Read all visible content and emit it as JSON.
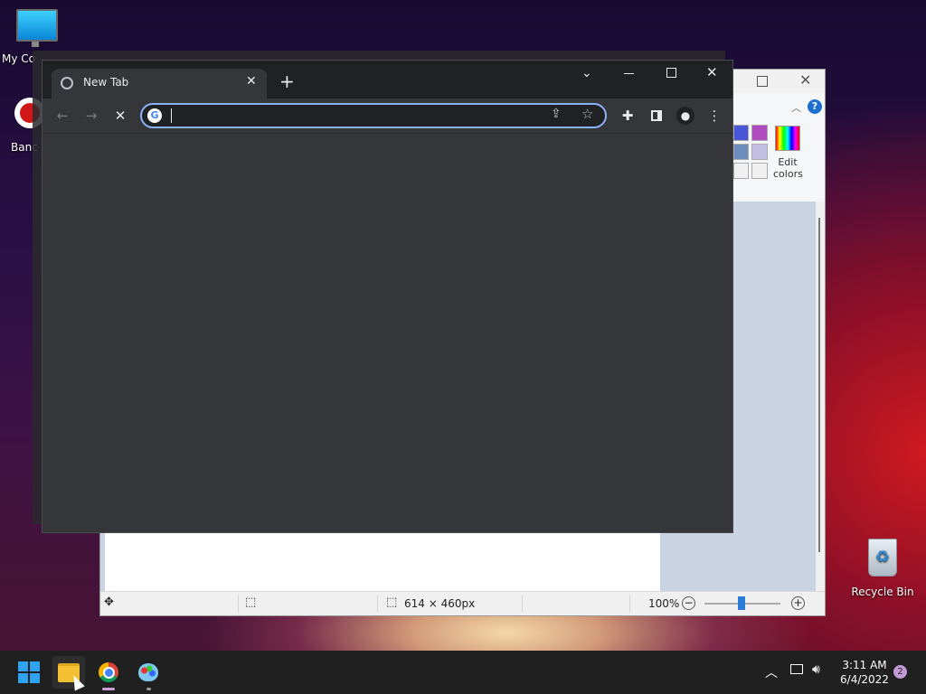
{
  "desktop": {
    "icons": [
      {
        "label": "My Co"
      },
      {
        "label": "Banc"
      },
      {
        "label": "Recycle Bin"
      }
    ]
  },
  "paint": {
    "edit_colors_line1": "Edit",
    "edit_colors_line2": "colors",
    "help_glyph": "?",
    "status": {
      "dimensions": "614 × 460px",
      "zoom": "100%",
      "zoom_level": 1.0
    }
  },
  "chrome": {
    "tab_title": "New Tab",
    "omnibox_value": "",
    "colors": {
      "accent": "#8ab4f8",
      "frame": "#202124",
      "toolbar": "#35363a"
    }
  },
  "taskbar": {
    "time": "3:11 AM",
    "date": "6/4/2022",
    "notification_count": "2"
  }
}
